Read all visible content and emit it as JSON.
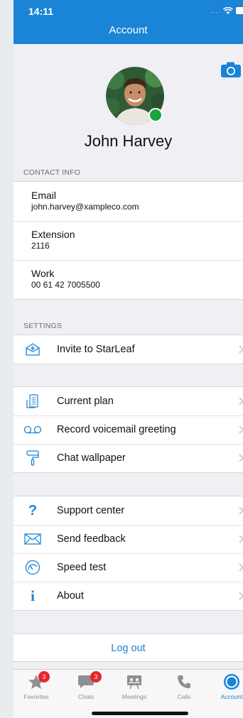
{
  "status": {
    "time": "14:11"
  },
  "header": {
    "title": "Account"
  },
  "profile": {
    "name": "John Harvey",
    "presence_color": "#1aa33a"
  },
  "contact_info": {
    "section_title": "CONTACT INFO",
    "rows": [
      {
        "label": "Email",
        "value": "john.harvey@xampleco.com"
      },
      {
        "label": "Extension",
        "value": "2116"
      },
      {
        "label": "Work",
        "value": "00 61 42 7005500"
      }
    ]
  },
  "settings": {
    "section_title": "SETTINGS",
    "group1": [
      {
        "label": "Invite to StarLeaf",
        "icon": "invite-icon"
      }
    ],
    "group2": [
      {
        "label": "Current plan",
        "icon": "plan-icon"
      },
      {
        "label": "Record voicemail greeting",
        "icon": "voicemail-icon"
      },
      {
        "label": "Chat wallpaper",
        "icon": "paint-roller-icon"
      }
    ],
    "group3": [
      {
        "label": "Support center",
        "icon": "question-icon"
      },
      {
        "label": "Send feedback",
        "icon": "envelope-icon"
      },
      {
        "label": "Speed test",
        "icon": "speedometer-icon"
      },
      {
        "label": "About",
        "icon": "info-icon"
      }
    ]
  },
  "logout": {
    "label": "Log out"
  },
  "tabbar": {
    "tabs": [
      {
        "label": "Favorites",
        "badge": "3"
      },
      {
        "label": "Chats",
        "badge": "3"
      },
      {
        "label": "Meetings"
      },
      {
        "label": "Calls"
      },
      {
        "label": "Account"
      }
    ]
  },
  "colors": {
    "accent": "#1a84d6",
    "badge": "#e5262c"
  }
}
